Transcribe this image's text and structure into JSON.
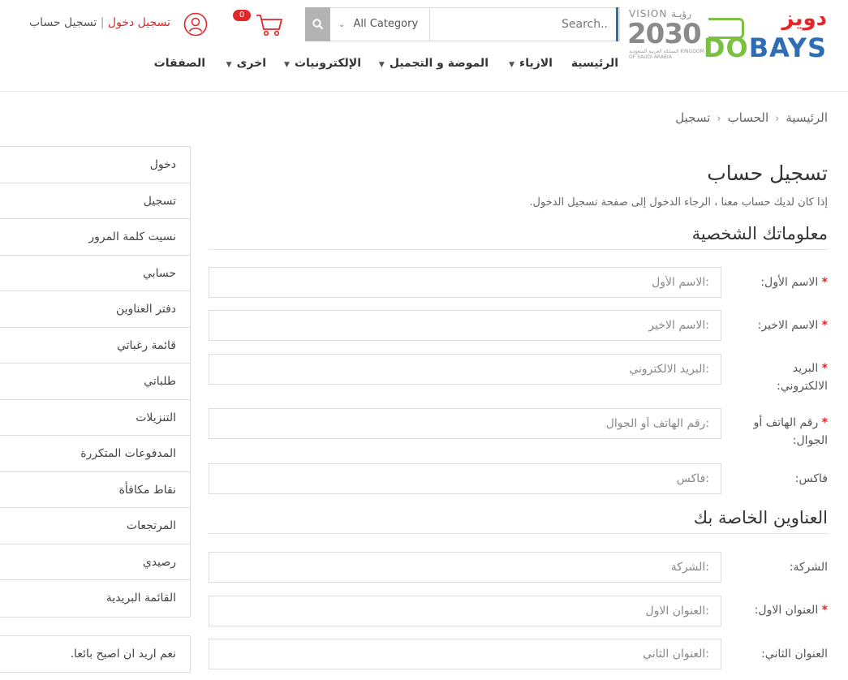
{
  "header": {
    "logo_ar": "دويز",
    "logo_en_do": "DO",
    "logo_en_bays": "BAYS",
    "vision_title": "VISION رؤيـة",
    "vision_year": "2030",
    "vision_sub": "المملكة العربية السعودية KINGDOM OF SAUDI ARABIA",
    "search_placeholder": "Search..",
    "category_label": "All Category",
    "cart_count": "0",
    "login_label": "تسجيل دخول",
    "separator": "|",
    "register_label": "تسجيل حساب"
  },
  "nav": [
    {
      "label": "الرئيسية",
      "has_caret": false
    },
    {
      "label": "الازياء",
      "has_caret": true
    },
    {
      "label": "الموضة و التجميل",
      "has_caret": true
    },
    {
      "label": "الإلكترونيات",
      "has_caret": true
    },
    {
      "label": "اخرى",
      "has_caret": true
    },
    {
      "label": "الصفقات",
      "has_caret": false
    }
  ],
  "breadcrumb": [
    "الرئيسية",
    "الحساب",
    "تسجيل"
  ],
  "main": {
    "title": "تسجيل حساب",
    "intro": "إذا كان لديك حساب معنا ، الرجاء الدخول إلى صفحة تسجيل الدخول.",
    "personal_title": "معلوماتك الشخصية",
    "address_title": "العناوين الخاصة بك",
    "required_mark": "*",
    "fields": {
      "first_name": {
        "label": "الاسم الأول:",
        "placeholder": "الاسم الأول:"
      },
      "last_name": {
        "label": "الاسم الاخير:",
        "placeholder": "الاسم الاخير:"
      },
      "email": {
        "label": "البريد الالكتروني:",
        "placeholder": "البريد الالكتروني:"
      },
      "phone": {
        "label": "رقم الهاتف أو الجوال:",
        "placeholder": "رقم الهاتف أو الجوال:"
      },
      "fax": {
        "label": "فاكس:",
        "placeholder": "فاكس:"
      },
      "company": {
        "label": "الشركة:",
        "placeholder": "الشركة:"
      },
      "address1": {
        "label": "العنوان الاول:",
        "placeholder": "العنوان الاول:"
      },
      "address2": {
        "label": "العنوان الثاني:",
        "placeholder": "العنوان الثاني:"
      }
    }
  },
  "sidebar": {
    "items": [
      "دخول",
      "تسجيل",
      "نسيت كلمة المرور",
      "حسابي",
      "دفتر العناوين",
      "قائمة رغباتي",
      "طلباتي",
      "التنزيلات",
      "المدفوعات المتكررة",
      "نقاط مكافأة",
      "المرتجعات",
      "رصيدي",
      "القائمة البريدية"
    ],
    "newsletter_label": "نعم اريد ان اصبح بائعا."
  },
  "colors": {
    "brand_red": "#e2262a",
    "brand_green": "#7ac142",
    "brand_blue": "#2e6db4"
  }
}
